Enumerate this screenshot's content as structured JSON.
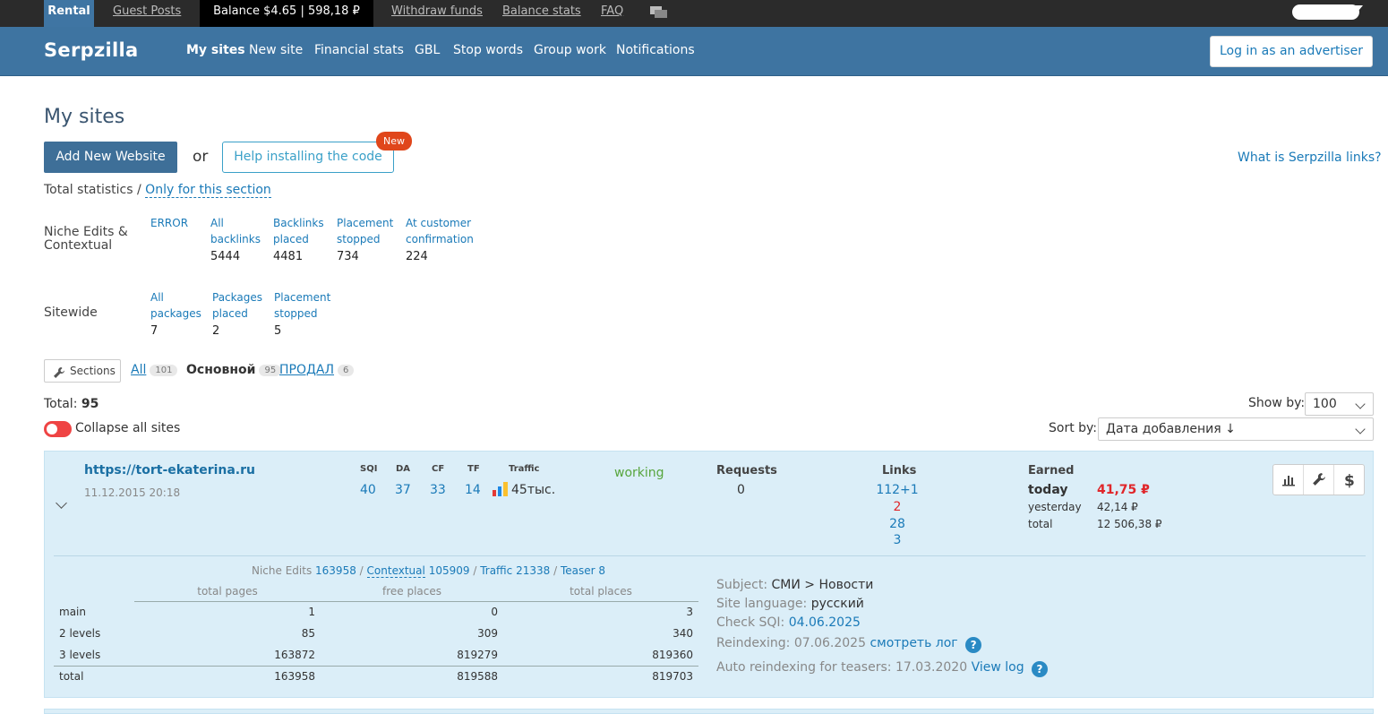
{
  "topbar": {
    "rental": "Rental",
    "guest_posts": "Guest Posts",
    "balance": "Balance $4.65 | 598,18 ₽",
    "withdraw": "Withdraw funds",
    "balance_stats": "Balance stats",
    "faq": "FAQ"
  },
  "header": {
    "logo": "Serpzilla",
    "nav": [
      "My sites",
      "New site",
      "Financial stats",
      "GBL",
      "Stop words",
      "Group work",
      "Notifications"
    ],
    "advertiser_button": "Log in as an advertiser"
  },
  "page": {
    "title": "My sites",
    "add_button": "Add New Website",
    "or": "or",
    "help_button": "Help installing the code",
    "new_badge": "New",
    "what_link": "What is Serpzilla links?",
    "total_stats": "Total statistics /",
    "only_section": "Only for this section"
  },
  "stats": {
    "niche_label": "Niche Edits & Contextual",
    "niche": [
      {
        "label": "ERROR",
        "value": ""
      },
      {
        "label": "All backlinks",
        "value": "5444"
      },
      {
        "label": "Backlinks placed",
        "value": "4481"
      },
      {
        "label": "Placement stopped",
        "value": "734"
      },
      {
        "label": "At customer confirmation",
        "value": "224"
      }
    ],
    "sitewide_label": "Sitewide",
    "sitewide": [
      {
        "label": "All packages",
        "value": "7"
      },
      {
        "label": "Packages placed",
        "value": "2"
      },
      {
        "label": "Placement stopped",
        "value": "5"
      }
    ]
  },
  "sections": {
    "button": "Sections",
    "tabs": [
      {
        "label": "All",
        "count": "101"
      },
      {
        "label": "Основной",
        "count": "95"
      },
      {
        "label": "ПРОДАЛ",
        "count": "6"
      }
    ]
  },
  "list": {
    "total_label": "Total:",
    "total_value": "95",
    "collapse_label": "Collapse all sites",
    "show_by_label": "Show by:",
    "show_by_value": "100",
    "sort_by_label": "Sort by:",
    "sort_by_value": "Дата добавления ↓"
  },
  "site": {
    "url": "https://tort-ekaterina.ru",
    "date": "11.12.2015 20:18",
    "metrics": [
      {
        "name": "SQI",
        "value": "40"
      },
      {
        "name": "DA",
        "value": "37"
      },
      {
        "name": "CF",
        "value": "33"
      },
      {
        "name": "TF",
        "value": "14"
      }
    ],
    "traffic_label": "Traffic",
    "traffic_value": "45тыс.",
    "status": "working",
    "requests_label": "Requests",
    "requests_value": "0",
    "links_label": "Links",
    "links": [
      "112+1",
      "2",
      "28",
      "3"
    ],
    "earned_label": "Earned",
    "today_label": "today",
    "today_value": "41,75 ₽",
    "yesterday_label": "yesterday",
    "yesterday_value": "42,14 ₽",
    "total_label": "total",
    "total_value": "12 506,38 ₽",
    "breakdown": {
      "niche": "Niche Edits",
      "niche_n": "163958",
      "sep1": "/",
      "contextual": "Contextual",
      "contextual_n": "105909",
      "sep2": "/",
      "traffic": "Traffic",
      "traffic_n": "21338",
      "sep3": "/",
      "teaser": "Teaser",
      "teaser_n": "8"
    },
    "table": {
      "headers": [
        "total pages",
        "free places",
        "total places"
      ],
      "rows": [
        {
          "label": "main",
          "cells": [
            "1",
            "0",
            "3"
          ]
        },
        {
          "label": "2 levels",
          "cells": [
            "85",
            "309",
            "340"
          ]
        },
        {
          "label": "3 levels",
          "cells": [
            "163872",
            "819279",
            "819360"
          ]
        },
        {
          "label": "total",
          "cells": [
            "163958",
            "819588",
            "819703"
          ]
        }
      ]
    },
    "info": {
      "subject_label": "Subject:",
      "subject_value": "СМИ > Новости",
      "language_label": "Site language:",
      "language_value": "русский",
      "check_sqi_label": "Check SQI:",
      "check_sqi_value": "04.06.2025",
      "reindex_label": "Reindexing: 07.06.2025",
      "reindex_link": "смотреть лог",
      "auto_label": "Auto reindexing for teasers:",
      "auto_value": "17.03.2020",
      "auto_link": "View log",
      "help": "?"
    }
  }
}
